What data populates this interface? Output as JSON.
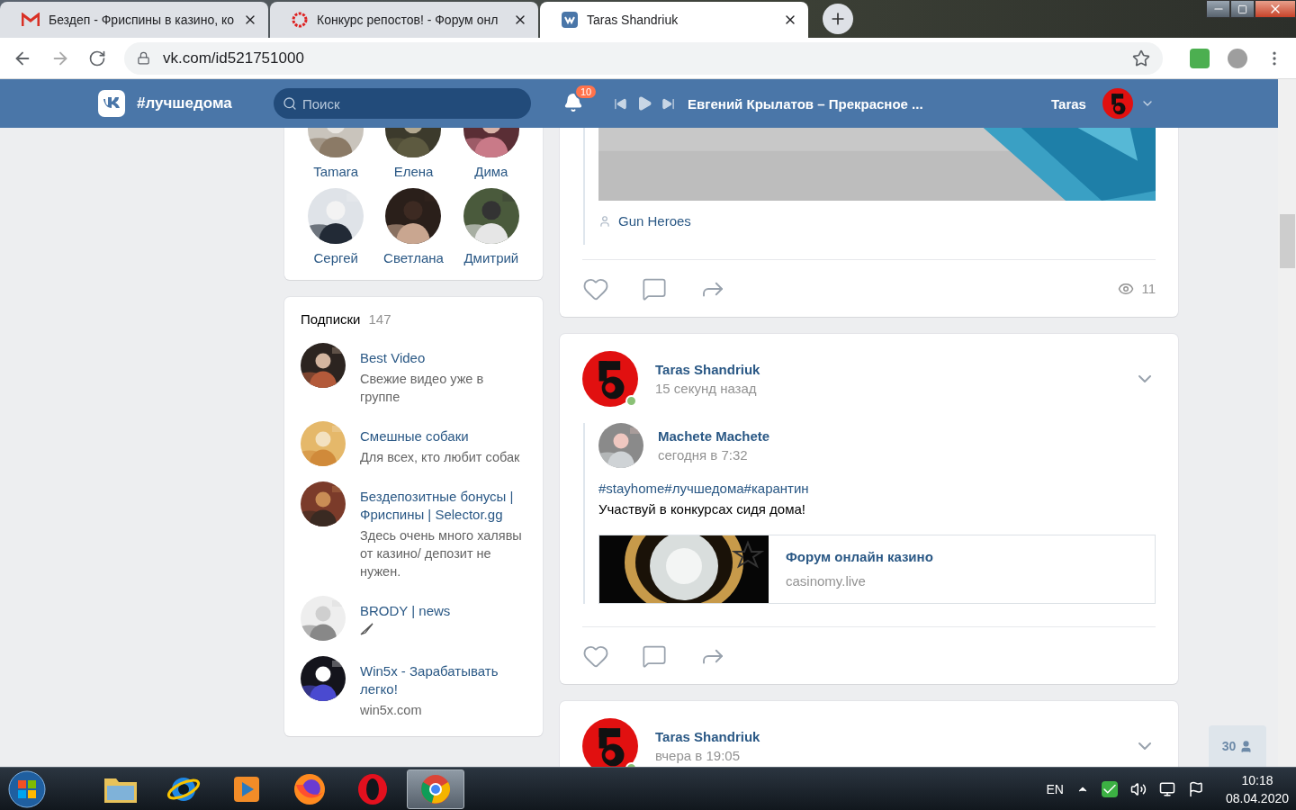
{
  "browser": {
    "tabs": [
      {
        "kind": "mail",
        "title": "Бездеп - Фриспины в казино, ко",
        "selected": false
      },
      {
        "kind": "ring",
        "title": "Конкурс репостов! - Форум онл",
        "selected": false
      },
      {
        "kind": "site",
        "title": "Taras Shandriuk",
        "selected": true
      }
    ],
    "address": "vk.com/id521751000"
  },
  "header": {
    "title": "#лучшедома",
    "search": {
      "placeholder": "Поиск"
    },
    "notifications": "10",
    "track": "Евгений Крылатов – Прекрасное ...",
    "user": "Taras"
  },
  "friends": [
    {
      "name": "Tamara"
    },
    {
      "name": "Елена"
    },
    {
      "name": "Дима"
    },
    {
      "name": "Сергей"
    },
    {
      "name": "Светлана"
    },
    {
      "name": "Дмитрий"
    }
  ],
  "subscriptions": {
    "title": "Подписки",
    "count": "147",
    "items": [
      {
        "kind": "text",
        "name": "Best Video",
        "description": "Свежие видео уже в группе"
      },
      {
        "kind": "text",
        "name": "Смешные собаки",
        "description": "Для всех, кто любит собак"
      },
      {
        "kind": "text",
        "name": "Бездепозитные бонусы | Фриспины | Selector.gg",
        "description": "Здесь очень много халявы от казино/ депозит не нужен."
      },
      {
        "kind": "icon",
        "name": "BRODY | news"
      },
      {
        "kind": "text",
        "name": "Win5x - Зарабатывать легко!",
        "description": "win5x.com"
      }
    ]
  },
  "feed": [
    {
      "kind": "tail",
      "source": "Gun Heroes",
      "views": "11"
    },
    {
      "kind": "repost",
      "author": "Taras Shandriuk",
      "time": "15 секунд назад",
      "online": true,
      "repost": {
        "author": "Machete Machete",
        "time": "сегодня в 7:32",
        "hashtags": "#stayhome#лучшедома#карантин",
        "text": "Участвуй в конкурсах сидя дома!",
        "link": {
          "title": "Форум онлайн казино",
          "domain": "casinomy.live"
        }
      }
    },
    {
      "kind": "cut",
      "author": "Taras Shandriuk",
      "time": "вчера в 19:05",
      "online": true
    }
  ],
  "side_button": {
    "label": "30"
  },
  "taskbar": {
    "apps": [
      {
        "kind": "folder",
        "selected": false
      },
      {
        "kind": "ie",
        "selected": false
      },
      {
        "kind": "player",
        "selected": false
      },
      {
        "kind": "fox",
        "selected": false
      },
      {
        "kind": "opera",
        "selected": false
      },
      {
        "kind": "chrome",
        "selected": true
      }
    ],
    "language": "EN",
    "time": "10:18",
    "date": "08.04.2020"
  }
}
